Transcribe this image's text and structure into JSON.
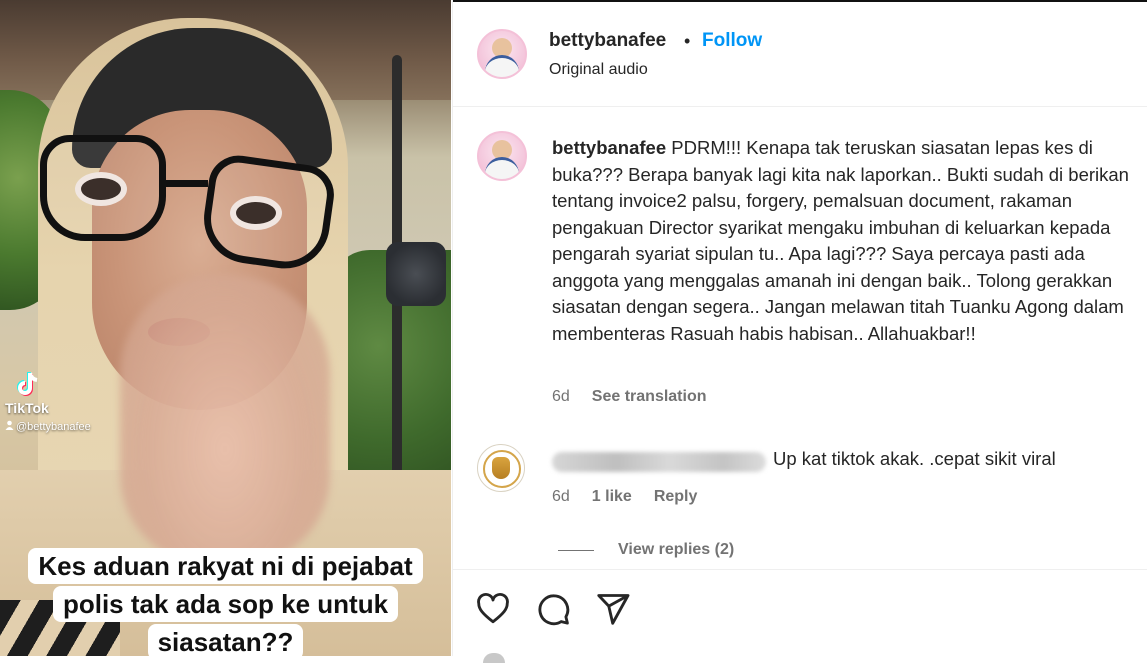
{
  "video": {
    "tiktok_brand": "TikTok",
    "tiktok_handle": "@bettybanafee",
    "caption_lines": [
      "Kes aduan rakyat ni di pejabat",
      "polis tak ada sop ke untuk",
      "siasatan??"
    ]
  },
  "post": {
    "username": "bettybanafee",
    "separator": "•",
    "follow_label": "Follow",
    "audio_label": "Original audio",
    "accent_color": "#0095f6"
  },
  "comments": [
    {
      "username": "bettybanafee",
      "text": "PDRM!!! Kenapa tak teruskan siasatan lepas kes di buka??? Berapa banyak lagi kita nak laporkan.. Bukti sudah di berikan tentang invoice2 palsu, forgery, pemalsuan document, rakaman pengakuan Director syarikat mengaku imbuhan di keluarkan kepada pengarah syariat sipulan tu.. Apa lagi??? Saya percaya pasti ada anggota yang menggalas amanah ini dengan baik.. Tolong gerakkan siasatan dengan segera.. Jangan melawan titah Tuanku Agong dalam membenteras Rasuah habis habisan.. Allahuakbar!!",
      "age": "6d",
      "see_translation": "See translation"
    },
    {
      "username": "",
      "text": "Up kat tiktok akak. .cepat sikit viral",
      "age": "6d",
      "likes": "1 like",
      "reply_label": "Reply",
      "view_replies": "View replies (2)"
    }
  ],
  "actions": {
    "like_icon": "heart-icon",
    "comment_icon": "comment-icon",
    "share_icon": "share-icon"
  }
}
